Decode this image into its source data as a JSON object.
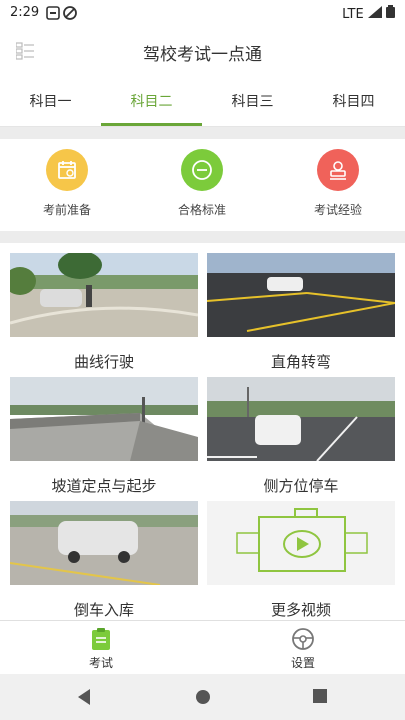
{
  "status": {
    "time": "2:29",
    "network": "LTE"
  },
  "app": {
    "title": "驾校考试一点通"
  },
  "tabs": [
    {
      "label": "科目一"
    },
    {
      "label": "科目二"
    },
    {
      "label": "科目三"
    },
    {
      "label": "科目四"
    }
  ],
  "active_tab": "科目二",
  "shortcuts": [
    {
      "label": "考前准备",
      "icon": "calendar-icon",
      "color": "#f6c649"
    },
    {
      "label": "合格标准",
      "icon": "minus-circle-icon",
      "color": "#7ccb3b"
    },
    {
      "label": "考试经验",
      "icon": "stamp-icon",
      "color": "#f0625a"
    }
  ],
  "videos": [
    {
      "caption": "曲线行驶"
    },
    {
      "caption": "直角转弯"
    },
    {
      "caption": "坡道定点与起步"
    },
    {
      "caption": "侧方位停车"
    },
    {
      "caption": "倒车入库"
    },
    {
      "caption": "更多视频"
    }
  ],
  "bottom_nav": [
    {
      "label": "考试",
      "icon": "clipboard-icon"
    },
    {
      "label": "设置",
      "icon": "steering-wheel-icon"
    }
  ],
  "colors": {
    "accent": "#6aa638"
  }
}
